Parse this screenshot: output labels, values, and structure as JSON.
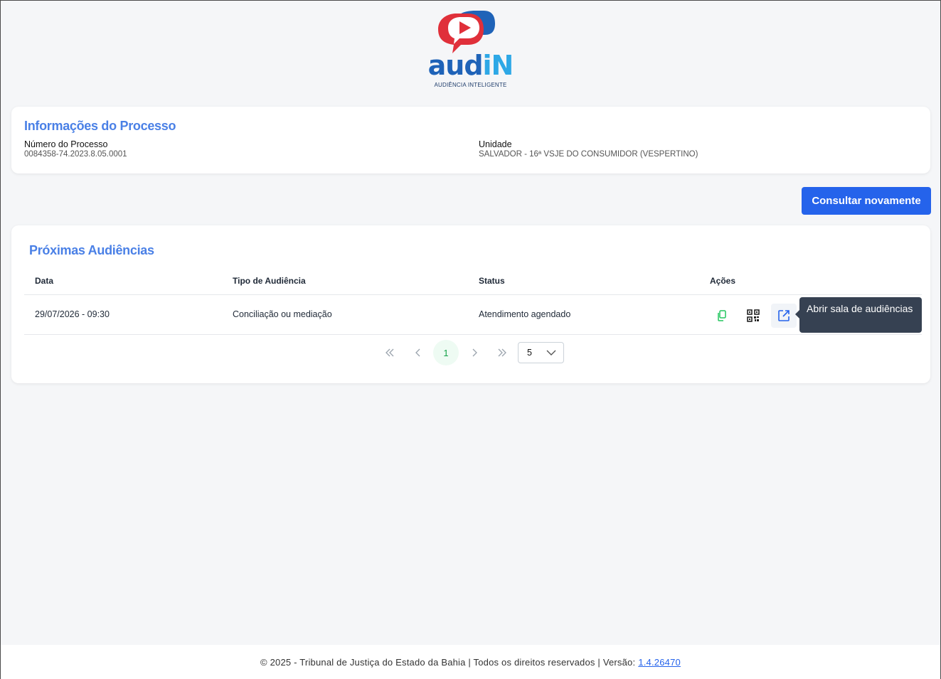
{
  "logo": {
    "word_main": "aud",
    "word_accent": "iN",
    "tagline": "AUDIÊNCIA INTELIGENTE",
    "brand_red": "#e0303a",
    "brand_blue": "#1f63b8"
  },
  "process_info": {
    "title": "Informações do Processo",
    "number_label": "Número do Processo",
    "number_value": "0084358-74.2023.8.05.0001",
    "unit_label": "Unidade",
    "unit_value": "SALVADOR - 16ª VSJE DO CONSUMIDOR (VESPERTINO)"
  },
  "actions": {
    "refresh_label": "Consultar novamente",
    "accent": "#2563eb"
  },
  "hearings": {
    "title": "Próximas Audiências",
    "columns": [
      "Data",
      "Tipo de Audiência",
      "Status",
      "Ações"
    ],
    "rows": [
      {
        "date": "29/07/2026 - 09:30",
        "type": "Conciliação ou mediação",
        "status": "Atendimento agendado"
      }
    ],
    "row_actions": [
      "copy-icon",
      "qr-code-icon",
      "external-link-icon"
    ],
    "tooltip": "Abrir sala de audiências",
    "pagination": {
      "current_page": "1",
      "page_size": "5"
    }
  },
  "footer": {
    "text": "© 2025 - Tribunal de Justiça do Estado da Bahia | Todos os direitos reservados | Versão:",
    "version": "1.4.26470"
  }
}
